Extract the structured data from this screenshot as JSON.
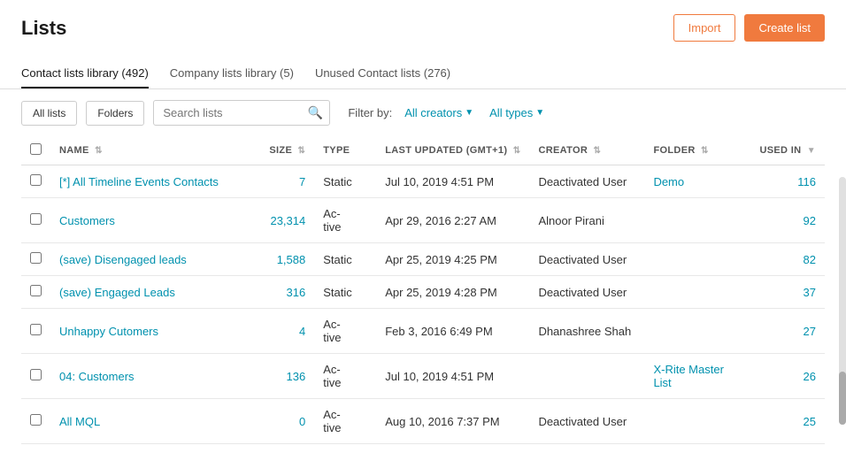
{
  "page": {
    "title": "Lists"
  },
  "header_buttons": {
    "import_label": "Import",
    "create_label": "Create list"
  },
  "tabs": [
    {
      "label": "Contact lists library (492)",
      "active": true
    },
    {
      "label": "Company lists library (5)",
      "active": false
    },
    {
      "label": "Unused Contact lists (276)",
      "active": false
    }
  ],
  "toolbar": {
    "all_lists_label": "All lists",
    "folders_label": "Folders",
    "search_placeholder": "Search lists",
    "filter_label": "Filter by:",
    "all_creators_label": "All creators",
    "all_types_label": "All types"
  },
  "table": {
    "columns": [
      {
        "key": "name",
        "label": "NAME"
      },
      {
        "key": "size",
        "label": "SIZE"
      },
      {
        "key": "type",
        "label": "TYPE"
      },
      {
        "key": "updated",
        "label": "LAST UPDATED (GMT+1)"
      },
      {
        "key": "creator",
        "label": "CREATOR"
      },
      {
        "key": "folder",
        "label": "FOLDER"
      },
      {
        "key": "used_in",
        "label": "USED IN"
      }
    ],
    "rows": [
      {
        "name": "[*] All Timeline Events Contacts",
        "size": "7",
        "type": "Static",
        "updated": "Jul 10, 2019 4:51 PM",
        "creator": "Deactivated User",
        "folder": "Demo",
        "used_in": "116"
      },
      {
        "name": "Customers",
        "size": "23,314",
        "type": "Ac­tive",
        "updated": "Apr 29, 2016 2:27 AM",
        "creator": "Alnoor Pirani",
        "folder": "",
        "used_in": "92"
      },
      {
        "name": "(save) Disengaged leads",
        "size": "1,588",
        "type": "Static",
        "updated": "Apr 25, 2019 4:25 PM",
        "creator": "Deactivated User",
        "folder": "",
        "used_in": "82"
      },
      {
        "name": "(save) Engaged Leads",
        "size": "316",
        "type": "Static",
        "updated": "Apr 25, 2019 4:28 PM",
        "creator": "Deactivated User",
        "folder": "",
        "used_in": "37"
      },
      {
        "name": "Unhappy Cutomers",
        "size": "4",
        "type": "Ac­tive",
        "updated": "Feb 3, 2016 6:49 PM",
        "creator": "Dhanashree Shah",
        "folder": "",
        "used_in": "27"
      },
      {
        "name": "04: Customers",
        "size": "136",
        "type": "Ac­tive",
        "updated": "Jul 10, 2019 4:51 PM",
        "creator": "",
        "folder": "X-Rite Master List",
        "used_in": "26"
      },
      {
        "name": "All MQL",
        "size": "0",
        "type": "Ac­tive",
        "updated": "Aug 10, 2016 7:37 PM",
        "creator": "Deactivated User",
        "folder": "",
        "used_in": "25"
      }
    ]
  }
}
